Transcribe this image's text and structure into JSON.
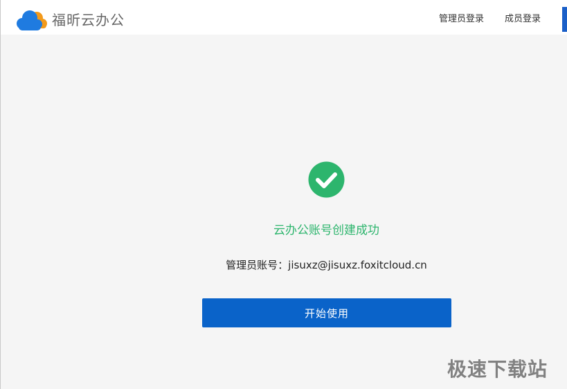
{
  "header": {
    "logo_text": "福昕云办公",
    "nav": {
      "admin_login": "管理员登录",
      "member_login": "成员登录"
    }
  },
  "main": {
    "success_title": "云办公账号创建成功",
    "account_label": "管理员账号：",
    "account_value": "jisuxz@jisuxz.foxitcloud.cn",
    "start_button_label": "开始使用"
  },
  "watermark": {
    "text": "极速下载站"
  },
  "colors": {
    "brand_blue": "#0a63c9",
    "logo_blue": "#1f7be0",
    "logo_orange": "#f39a1b",
    "success_green": "#2db56d",
    "background": "#f5f5f5",
    "header_background": "#ffffff"
  },
  "icons": {
    "logo": "cloud-logo-icon",
    "success": "success-check-icon"
  }
}
